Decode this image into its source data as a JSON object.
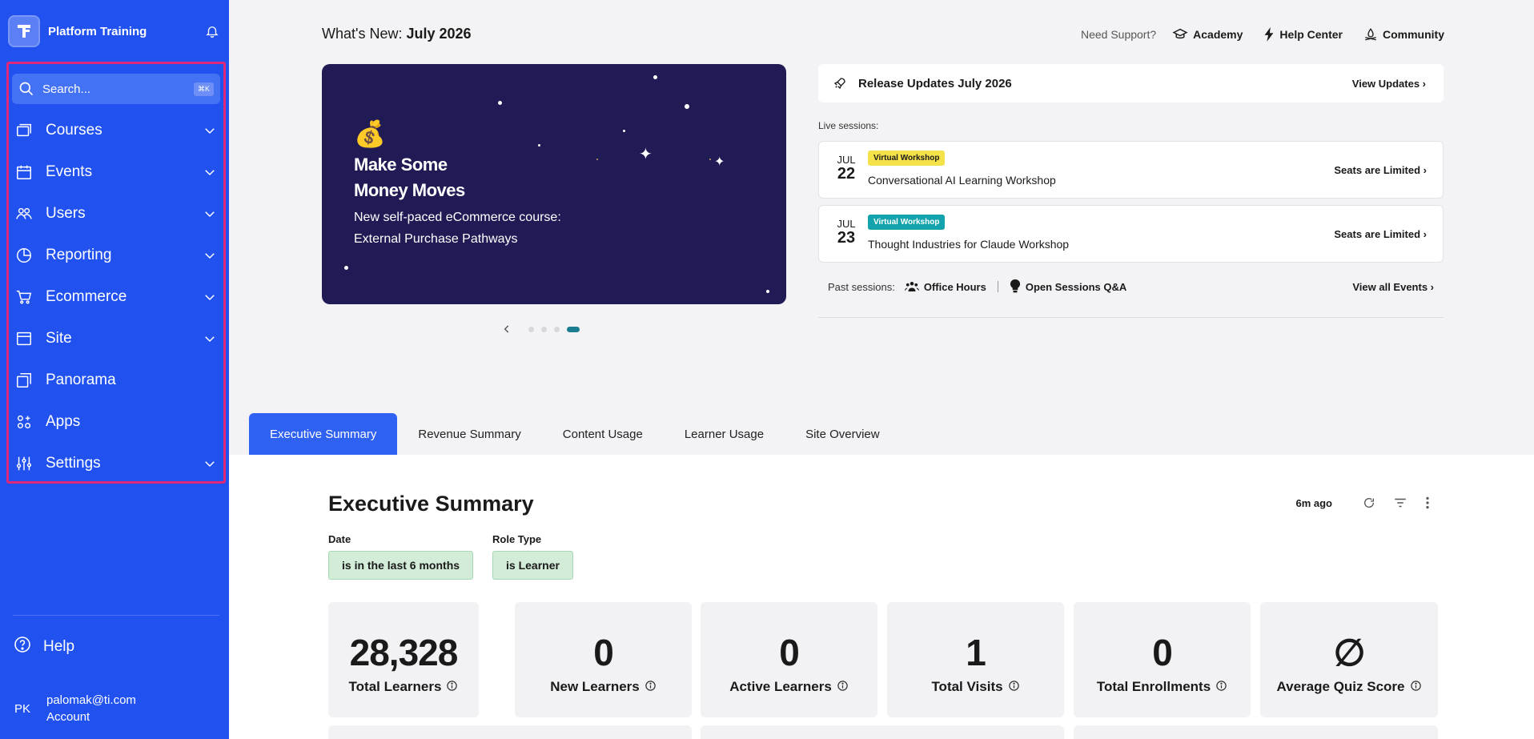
{
  "sidebar": {
    "brand": "Platform Training",
    "search_placeholder": "Search...",
    "search_shortcut": "⌘K",
    "items": [
      {
        "label": "Courses"
      },
      {
        "label": "Events"
      },
      {
        "label": "Users"
      },
      {
        "label": "Reporting"
      },
      {
        "label": "Ecommerce"
      },
      {
        "label": "Site"
      },
      {
        "label": "Panorama"
      },
      {
        "label": "Apps"
      },
      {
        "label": "Settings"
      }
    ],
    "help_label": "Help",
    "account": {
      "initials": "PK",
      "email": "palomak@ti.com",
      "label": "Account"
    }
  },
  "header": {
    "whats_new_prefix": "What's New:",
    "whats_new_month": "July 2026",
    "need_support": "Need Support?",
    "links": [
      "Academy",
      "Help Center",
      "Community"
    ]
  },
  "banner": {
    "emoji": "💰",
    "headline_line1": "Make Some",
    "headline_line2": "Money Moves",
    "sub_line1": "New self-paced eCommerce course:",
    "sub_line2": "External Purchase Pathways",
    "slide_count": 4,
    "active_slide": 4
  },
  "release": {
    "title": "Release Updates July 2026",
    "link": "View Updates ›"
  },
  "live_label": "Live sessions:",
  "sessions": [
    {
      "month": "JUL",
      "day": "22",
      "badge": "Virtual Workshop",
      "badge_color": "#f5e14a",
      "badge_text_color": "#1a1a1a",
      "name": "Conversational AI Learning Workshop",
      "cta": "Seats are Limited ›"
    },
    {
      "month": "JUL",
      "day": "23",
      "badge": "Virtual Workshop",
      "badge_color": "#12a3ad",
      "badge_text_color": "#ffffff",
      "name": "Thought Industries for Claude Workshop",
      "cta": "Seats are Limited ›"
    }
  ],
  "past": {
    "label": "Past sessions:",
    "item1": "Office Hours",
    "item2": "Open Sessions Q&A",
    "all": "View all Events ›"
  },
  "tabs": [
    "Executive Summary",
    "Revenue Summary",
    "Content Usage",
    "Learner Usage",
    "Site Overview"
  ],
  "summary": {
    "title": "Executive Summary",
    "updated": "6m ago",
    "filters": [
      {
        "label": "Date",
        "value": "is in the last 6 months"
      },
      {
        "label": "Role Type",
        "value": "is Learner"
      }
    ],
    "cards": [
      {
        "value": "28,328",
        "label": "Total Learners"
      },
      {
        "value": "0",
        "label": "New Learners"
      },
      {
        "value": "0",
        "label": "Active Learners"
      },
      {
        "value": "1",
        "label": "Total Visits"
      },
      {
        "value": "0",
        "label": "Total Enrollments"
      },
      {
        "value": "∅",
        "label": "Average Quiz Score"
      }
    ]
  },
  "colors": {
    "sidebar": "#2152f0",
    "accent": "#2f62f2",
    "nav_highlight_border": "#e0287a",
    "chip_bg": "#d2ecd8"
  }
}
